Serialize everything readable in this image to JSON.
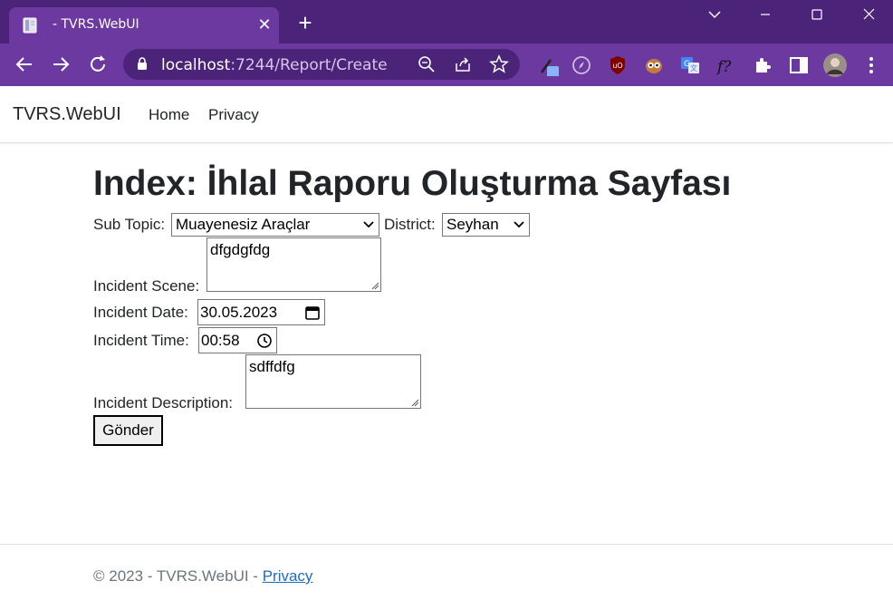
{
  "browser": {
    "tab_title": "- TVRS.WebUI",
    "url_host": "localhost",
    "url_path": ":7244/Report/Create"
  },
  "app": {
    "brand": "TVRS.WebUI",
    "nav": {
      "home": "Home",
      "privacy": "Privacy"
    }
  },
  "page": {
    "title": "Index: İhlal Raporu Oluşturma Sayfası"
  },
  "form": {
    "sub_topic_label": "Sub Topic:",
    "sub_topic_value": "Muayenesiz Araçlar",
    "district_label": "District:",
    "district_value": "Seyhan",
    "incident_scene_label": "Incident Scene:",
    "incident_scene_value": "dfgdgfdg",
    "incident_date_label": "Incident Date:",
    "incident_date_value": "30.05.2023",
    "incident_time_label": "Incident Time:",
    "incident_time_value": "00:58",
    "incident_description_label": "Incident Description:",
    "incident_description_value": "sdffdfg",
    "submit_label": "Gönder"
  },
  "footer": {
    "copyright": "© 2023 - TVRS.WebUI - ",
    "privacy_link": "Privacy"
  },
  "colors": {
    "chrome_dark": "#4b2479",
    "chrome_light": "#6c39a0",
    "link": "#1b6ec2"
  }
}
